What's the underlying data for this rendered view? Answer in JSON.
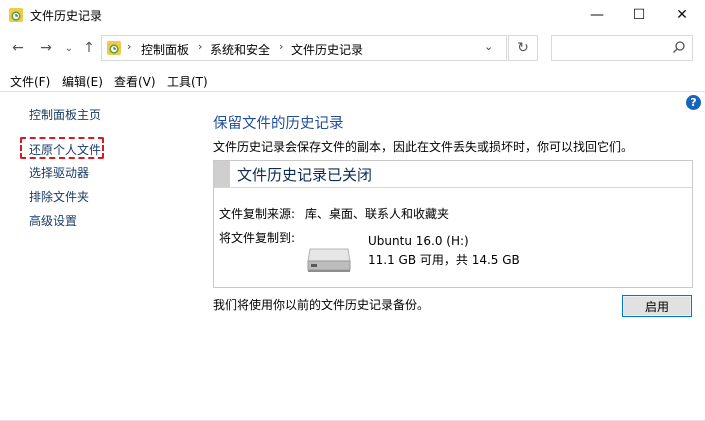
{
  "window": {
    "title": "文件历史记录",
    "minimize_glyph": "—",
    "maximize_glyph": "☐",
    "close_glyph": "✕"
  },
  "address_bar": {
    "breadcrumbs": [
      "控制面板",
      "系统和安全",
      "文件历史记录"
    ],
    "separator": "›",
    "dropdown_glyph": "⌄",
    "refresh_glyph": "↻"
  },
  "nav": {
    "back_glyph": "←",
    "forward_glyph": "→",
    "recent_glyph": "⌄",
    "up_glyph": "↑"
  },
  "menu": [
    "文件(F)",
    "编辑(E)",
    "查看(V)",
    "工具(T)"
  ],
  "sidebar": {
    "items": [
      "控制面板主页",
      "还原个人文件",
      "选择驱动器",
      "排除文件夹",
      "高级设置"
    ]
  },
  "help_glyph": "?",
  "main": {
    "title": "保留文件的历史记录",
    "description": "文件历史记录会保存文件的副本，因此在文件丢失或损坏时，你可以找回它们。",
    "status": "文件历史记录已关闭",
    "source_label": "文件复制来源:",
    "source_value": "库、桌面、联系人和收藏夹",
    "target_label": "将文件复制到:",
    "drive_name": "Ubuntu 16.0 (H:)",
    "drive_space": "11.1 GB 可用，共 14.5 GB",
    "footer_note": "我们将使用你以前的文件历史记录备份。",
    "enable_button": "启用"
  },
  "colors": {
    "accent": "#1e4e9a",
    "link": "#1a3c66",
    "highlight_dashed": "#d71921",
    "button_border": "#0078d7"
  },
  "icons": [
    "file-history-icon",
    "search-icon",
    "drive-icon",
    "help-icon"
  ]
}
